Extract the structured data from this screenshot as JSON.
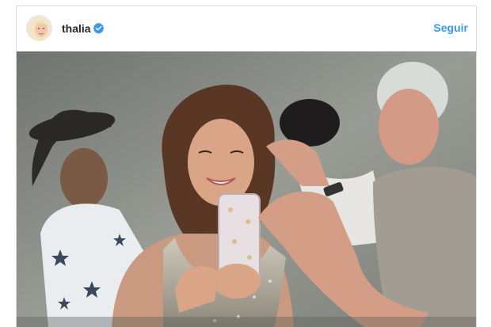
{
  "post": {
    "username": "thalia",
    "verified": true,
    "follow_label": "Seguir",
    "accent_color": "#3897f0"
  },
  "icons": {
    "verified": "verified-badge-icon",
    "avatar": "profile-avatar"
  }
}
